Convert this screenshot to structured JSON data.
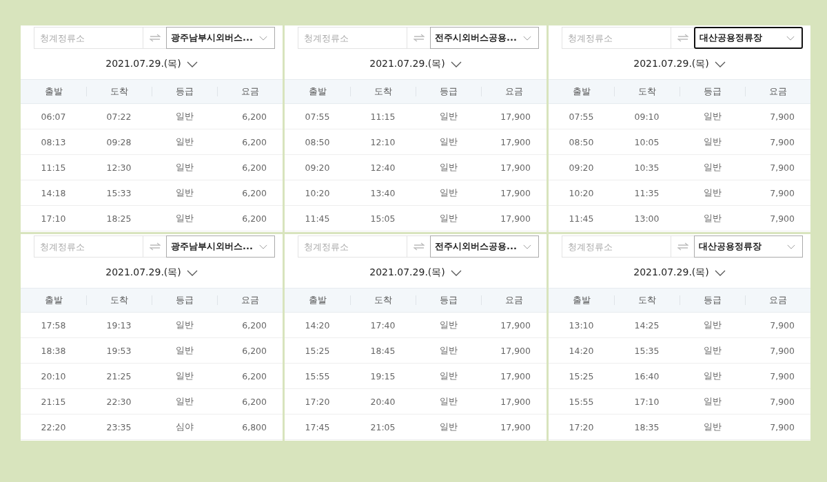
{
  "panels": [
    {
      "origin_placeholder": "청계정류소",
      "destination": {
        "value": "광주남부시외버스...",
        "focused": false
      },
      "date": "2021.07.29.(목)",
      "columns": [
        "출발",
        "도착",
        "등급",
        "요금"
      ],
      "rows": [
        [
          "06:07",
          "07:22",
          "일반",
          "6,200"
        ],
        [
          "08:13",
          "09:28",
          "일반",
          "6,200"
        ],
        [
          "11:15",
          "12:30",
          "일반",
          "6,200"
        ],
        [
          "14:18",
          "15:33",
          "일반",
          "6,200"
        ],
        [
          "17:10",
          "18:25",
          "일반",
          "6,200"
        ]
      ]
    },
    {
      "origin_placeholder": "청계정류소",
      "destination": {
        "value": "전주시외버스공용...",
        "focused": false
      },
      "date": "2021.07.29.(목)",
      "columns": [
        "출발",
        "도착",
        "등급",
        "요금"
      ],
      "rows": [
        [
          "07:55",
          "11:15",
          "일반",
          "17,900"
        ],
        [
          "08:50",
          "12:10",
          "일반",
          "17,900"
        ],
        [
          "09:20",
          "12:40",
          "일반",
          "17,900"
        ],
        [
          "10:20",
          "13:40",
          "일반",
          "17,900"
        ],
        [
          "11:45",
          "15:05",
          "일반",
          "17,900"
        ]
      ]
    },
    {
      "origin_placeholder": "청계정류소",
      "destination": {
        "value": "대산공용정류장",
        "focused": true
      },
      "date": "2021.07.29.(목)",
      "columns": [
        "출발",
        "도착",
        "등급",
        "요금"
      ],
      "rows": [
        [
          "07:55",
          "09:10",
          "일반",
          "7,900"
        ],
        [
          "08:50",
          "10:05",
          "일반",
          "7,900"
        ],
        [
          "09:20",
          "10:35",
          "일반",
          "7,900"
        ],
        [
          "10:20",
          "11:35",
          "일반",
          "7,900"
        ],
        [
          "11:45",
          "13:00",
          "일반",
          "7,900"
        ]
      ]
    },
    {
      "origin_placeholder": "청계정류소",
      "destination": {
        "value": "광주남부시외버스...",
        "focused": false
      },
      "date": "2021.07.29.(목)",
      "columns": [
        "출발",
        "도착",
        "등급",
        "요금"
      ],
      "rows": [
        [
          "17:58",
          "19:13",
          "일반",
          "6,200"
        ],
        [
          "18:38",
          "19:53",
          "일반",
          "6,200"
        ],
        [
          "20:10",
          "21:25",
          "일반",
          "6,200"
        ],
        [
          "21:15",
          "22:30",
          "일반",
          "6,200"
        ],
        [
          "22:20",
          "23:35",
          "심야",
          "6,800"
        ]
      ]
    },
    {
      "origin_placeholder": "청계정류소",
      "destination": {
        "value": "전주시외버스공용...",
        "focused": false
      },
      "date": "2021.07.29.(목)",
      "columns": [
        "출발",
        "도착",
        "등급",
        "요금"
      ],
      "rows": [
        [
          "14:20",
          "17:40",
          "일반",
          "17,900"
        ],
        [
          "15:25",
          "18:45",
          "일반",
          "17,900"
        ],
        [
          "15:55",
          "19:15",
          "일반",
          "17,900"
        ],
        [
          "17:20",
          "20:40",
          "일반",
          "17,900"
        ],
        [
          "17:45",
          "21:05",
          "일반",
          "17,900"
        ]
      ]
    },
    {
      "origin_placeholder": "청계정류소",
      "destination": {
        "value": "대산공용정류장",
        "focused": false
      },
      "date": "2021.07.29.(목)",
      "columns": [
        "출발",
        "도착",
        "등급",
        "요금"
      ],
      "rows": [
        [
          "13:10",
          "14:25",
          "일반",
          "7,900"
        ],
        [
          "14:20",
          "15:35",
          "일반",
          "7,900"
        ],
        [
          "15:25",
          "16:40",
          "일반",
          "7,900"
        ],
        [
          "15:55",
          "17:10",
          "일반",
          "7,900"
        ],
        [
          "17:20",
          "18:35",
          "일반",
          "7,900"
        ]
      ]
    }
  ]
}
